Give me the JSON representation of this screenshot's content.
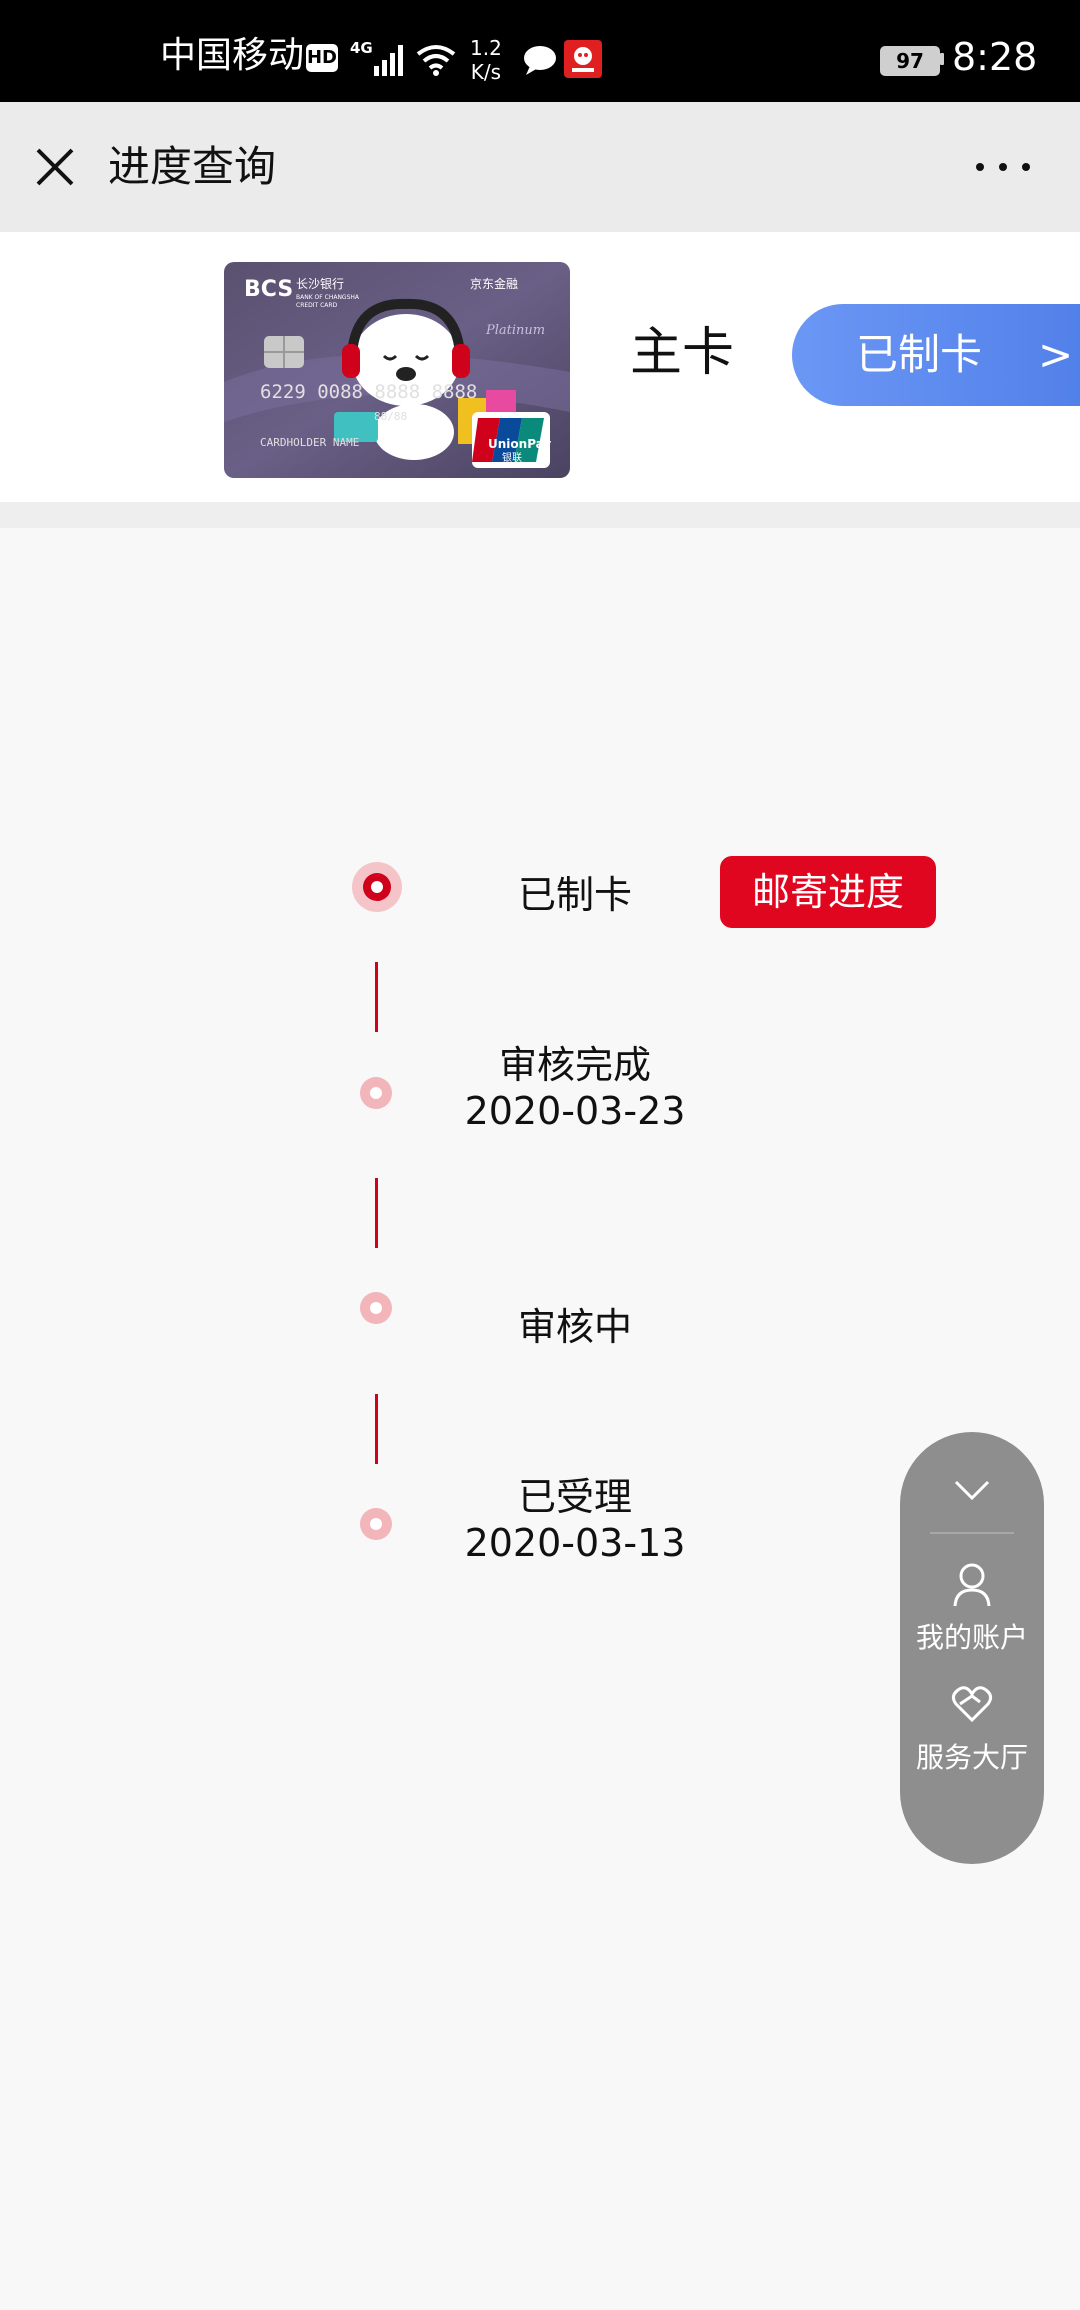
{
  "status_bar": {
    "carrier": "中国移动",
    "hd": "HD",
    "network": "4G",
    "speed_value": "1.2",
    "speed_unit": "K/s",
    "battery": "97",
    "time": "8:28"
  },
  "nav": {
    "title": "进度查询",
    "close_icon": "close-icon",
    "more_icon": "more-horizontal-icon"
  },
  "card": {
    "type_label": "主卡",
    "status_label": "已制卡",
    "status_arrow": ">",
    "image": {
      "bank_logo": "BCS",
      "bank_name": "长沙银行",
      "bank_en": "BANK OF CHANGSHA",
      "card_kind": "CREDIT CARD",
      "partner": "京东金融",
      "tier": "Platinum",
      "number": "6229 0088 8888 8888",
      "expiry": "88/88",
      "holder": "CARDHOLDER NAME",
      "network": "UnionPay",
      "network_cn": "银联"
    }
  },
  "timeline": {
    "steps": [
      {
        "title": "已制卡",
        "date": ""
      },
      {
        "title": "审核完成",
        "date": "2020-03-23"
      },
      {
        "title": "审核中",
        "date": ""
      },
      {
        "title": "已受理",
        "date": "2020-03-13"
      }
    ],
    "track_button": "邮寄进度"
  },
  "float_panel": {
    "collapse_icon": "chevron-down-icon",
    "account_label": "我的账户",
    "service_label": "服务大厅"
  },
  "colors": {
    "accent_red": "#d0021b",
    "pill_blue": "#5a88ee",
    "panel_gray": "#8e8e8e"
  }
}
